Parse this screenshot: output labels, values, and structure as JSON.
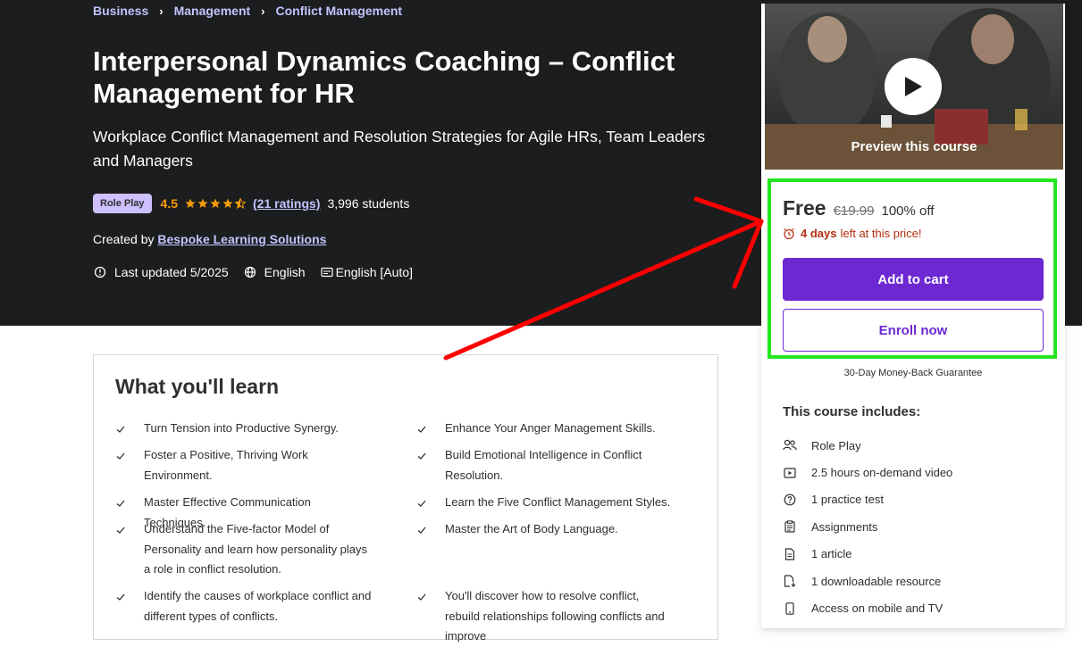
{
  "breadcrumb": [
    "Business",
    "Management",
    "Conflict Management"
  ],
  "title": "Interpersonal Dynamics Coaching – Conflict Management for HR",
  "subtitle": "Workplace Conflict Management and Resolution Strategies for Agile HRs, Team Leaders and Managers",
  "badge": "Role Play",
  "rating": "4.5",
  "rating_stars": 4.5,
  "ratings_count": "(21 ratings)",
  "students": "3,996 students",
  "created_by_label": "Created by",
  "author": "Bespoke Learning Solutions",
  "last_updated": "Last updated 5/2025",
  "language": "English",
  "captions": "English [Auto]",
  "sidebar": {
    "preview_label": "Preview this course",
    "price": "Free",
    "original_price": "€19.99",
    "discount": "100% off",
    "timer_days": "4 days",
    "timer_rest": "left at this price!",
    "add_to_cart": "Add to cart",
    "enroll_now": "Enroll now",
    "guarantee": "30-Day Money-Back Guarantee",
    "includes_title": "This course includes:",
    "includes": [
      {
        "icon": "users-icon",
        "label": "Role Play"
      },
      {
        "icon": "video-icon",
        "label": "2.5 hours on-demand video"
      },
      {
        "icon": "help-circle-icon",
        "label": "1 practice test"
      },
      {
        "icon": "clipboard-icon",
        "label": "Assignments"
      },
      {
        "icon": "file-icon",
        "label": "1 article"
      },
      {
        "icon": "download-icon",
        "label": "1 downloadable resource"
      },
      {
        "icon": "mobile-icon",
        "label": "Access on mobile and TV"
      }
    ]
  },
  "learn": {
    "title": "What you'll learn",
    "items": [
      "Turn Tension into Productive Synergy.",
      "Enhance Your Anger Management Skills.",
      "Foster a Positive, Thriving Work Environment.",
      "Build Emotional Intelligence in Conflict Resolution.",
      "Master Effective Communication Techniques.",
      "Learn the Five Conflict Management Styles.",
      "Understand the Five-factor Model of Personality and learn how personality plays a role in conflict resolution.",
      "Master the Art of Body Language.",
      "Identify the causes of workplace conflict and different types of conflicts.",
      "You'll discover how to resolve conflict, rebuild relationships following conflicts and improve"
    ]
  },
  "colors": {
    "hero_bg": "#1c1d1f",
    "link": "#c0c4fc",
    "accent": "#6d28d2",
    "star": "#f69c08",
    "highlight": "#22e51e",
    "arrow": "#ff0000"
  }
}
